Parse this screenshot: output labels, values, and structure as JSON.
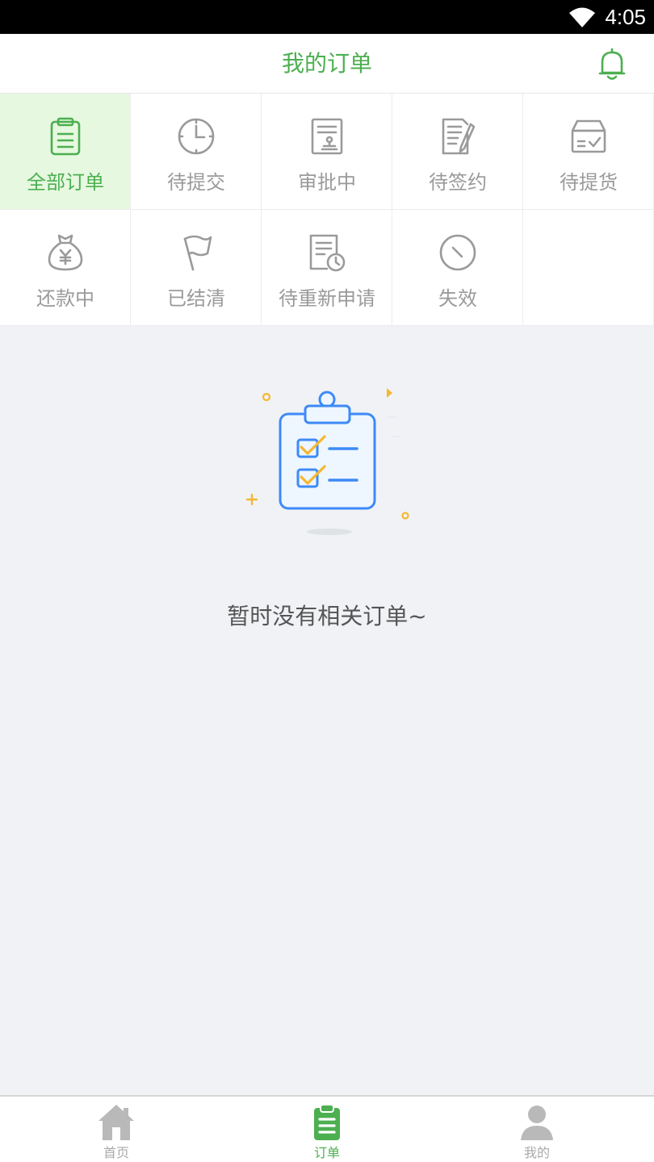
{
  "status_bar": {
    "time": "4:05"
  },
  "header": {
    "title": "我的订单"
  },
  "categories": [
    {
      "label": "全部订单",
      "icon": "clipboard-icon"
    },
    {
      "label": "待提交",
      "icon": "clock-icon"
    },
    {
      "label": "审批中",
      "icon": "document-stamp-icon"
    },
    {
      "label": "待签约",
      "icon": "document-pen-icon"
    },
    {
      "label": "待提货",
      "icon": "box-check-icon"
    },
    {
      "label": "还款中",
      "icon": "money-bag-icon"
    },
    {
      "label": "已结清",
      "icon": "flag-icon"
    },
    {
      "label": "待重新申请",
      "icon": "document-clock-icon"
    },
    {
      "label": "失效",
      "icon": "expired-circle-icon"
    }
  ],
  "empty_state": {
    "message": "暂时没有相关订单~"
  },
  "tabbar": {
    "items": [
      {
        "label": "首页",
        "icon": "home-icon"
      },
      {
        "label": "订单",
        "icon": "order-clipboard-icon"
      },
      {
        "label": "我的",
        "icon": "person-icon"
      }
    ]
  },
  "colors": {
    "accent": "#4caf50",
    "active_bg": "#e6f8e0",
    "inactive": "#9a9a9a",
    "background": "#f0f2f5"
  }
}
